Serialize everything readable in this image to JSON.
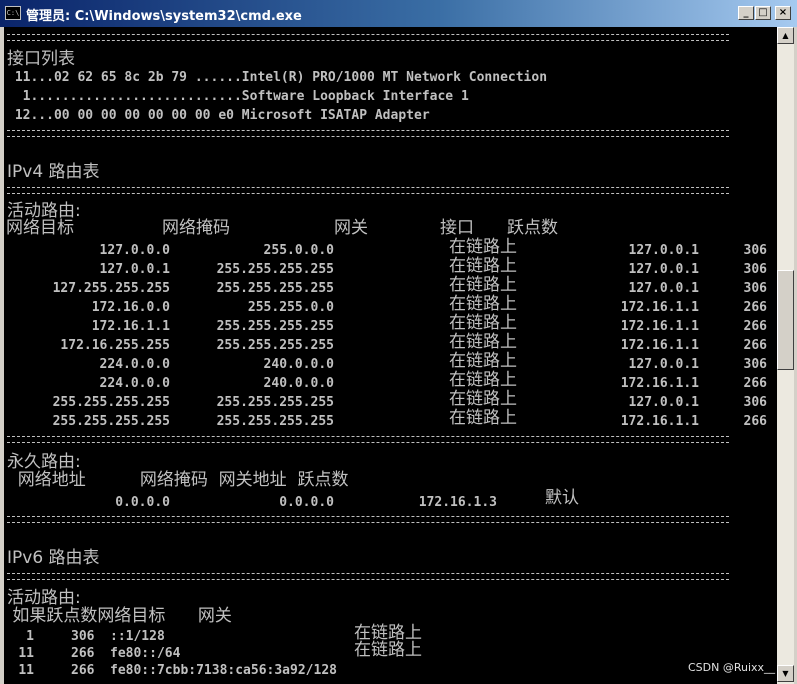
{
  "window": {
    "title": "管理员: C:\\Windows\\system32\\cmd.exe",
    "icon_text": "C:\\",
    "minimize": "_",
    "maximize": "□",
    "close": "×"
  },
  "separator": "==========================================================================",
  "interface_list": {
    "heading": "接口列表",
    "rows": [
      " 11...02 62 65 8c 2b 79 ......Intel(R) PRO/1000 MT Network Connection",
      "  1...........................Software Loopback Interface 1",
      " 12...00 00 00 00 00 00 00 e0 Microsoft ISATAP Adapter"
    ]
  },
  "ipv4": {
    "heading": "IPv4 路由表",
    "active_heading": "活动路由:",
    "columns": {
      "dest": "网络目标",
      "mask": "网络掩码",
      "gateway": "网关",
      "interface": "接口",
      "metric": "跃点数"
    },
    "rows": [
      {
        "dest": "127.0.0.0",
        "mask": "255.0.0.0",
        "gateway": "在链路上",
        "interface": "127.0.0.1",
        "metric": "306"
      },
      {
        "dest": "127.0.0.1",
        "mask": "255.255.255.255",
        "gateway": "在链路上",
        "interface": "127.0.0.1",
        "metric": "306"
      },
      {
        "dest": "127.255.255.255",
        "mask": "255.255.255.255",
        "gateway": "在链路上",
        "interface": "127.0.0.1",
        "metric": "306"
      },
      {
        "dest": "172.16.0.0",
        "mask": "255.255.0.0",
        "gateway": "在链路上",
        "interface": "172.16.1.1",
        "metric": "266"
      },
      {
        "dest": "172.16.1.1",
        "mask": "255.255.255.255",
        "gateway": "在链路上",
        "interface": "172.16.1.1",
        "metric": "266"
      },
      {
        "dest": "172.16.255.255",
        "mask": "255.255.255.255",
        "gateway": "在链路上",
        "interface": "172.16.1.1",
        "metric": "266"
      },
      {
        "dest": "224.0.0.0",
        "mask": "240.0.0.0",
        "gateway": "在链路上",
        "interface": "127.0.0.1",
        "metric": "306"
      },
      {
        "dest": "224.0.0.0",
        "mask": "240.0.0.0",
        "gateway": "在链路上",
        "interface": "172.16.1.1",
        "metric": "266"
      },
      {
        "dest": "255.255.255.255",
        "mask": "255.255.255.255",
        "gateway": "在链路上",
        "interface": "127.0.0.1",
        "metric": "306"
      },
      {
        "dest": "255.255.255.255",
        "mask": "255.255.255.255",
        "gateway": "在链路上",
        "interface": "172.16.1.1",
        "metric": "266"
      }
    ],
    "persistent": {
      "heading": "永久路由:",
      "columns_line": "  网络地址          网络掩码  网关地址  跃点数",
      "row": {
        "addr": "0.0.0.0",
        "mask": "0.0.0.0",
        "gateway": "172.16.1.3",
        "metric": "默认"
      }
    }
  },
  "ipv6": {
    "heading": "IPv6 路由表",
    "active_heading": "活动路由:",
    "columns_line": " 如果跃点数网络目标      网关",
    "rows": [
      {
        "if": "1",
        "metric": "306",
        "dest": "::1/128",
        "gateway": "在链路上"
      },
      {
        "if": "11",
        "metric": "266",
        "dest": "fe80::/64",
        "gateway": "在链路上"
      },
      {
        "if": "11",
        "metric": "266",
        "dest": "fe80::7cbb:7138:ca56:3a92/128",
        "gateway": ""
      }
    ]
  },
  "scrollbar": {
    "up": "▲",
    "down": "▼"
  },
  "watermark": "CSDN @Ruixx__"
}
